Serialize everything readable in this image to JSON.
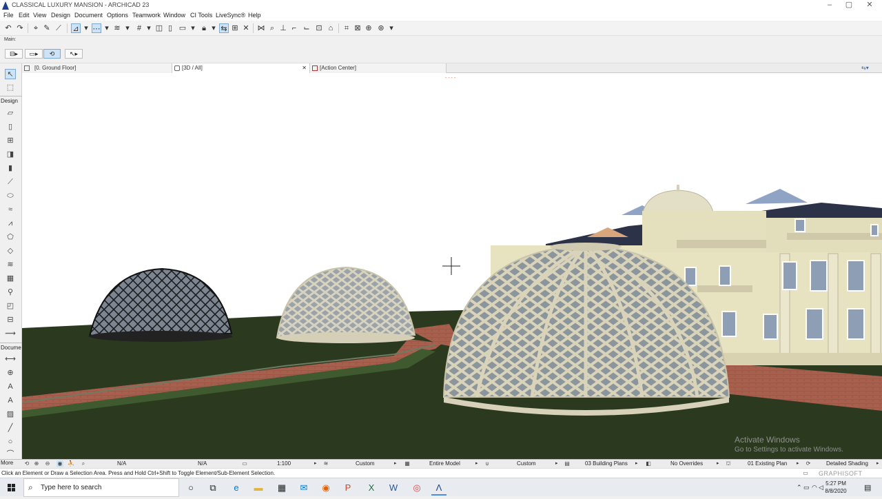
{
  "window": {
    "title": "CLASSICAL LUXURY MANSION - ARCHICAD 23",
    "controls": [
      "–",
      "▢",
      "✕"
    ]
  },
  "menu": [
    "File",
    "Edit",
    "View",
    "Design",
    "Document",
    "Options",
    "Teamwork",
    "Window",
    "CI Tools",
    "LiveSync®",
    "Help"
  ],
  "toolbar2": {
    "label": "Main:"
  },
  "tabs": [
    {
      "label": "[0. Ground Floor]"
    },
    {
      "label": "[3D / All]",
      "close": "✕"
    },
    {
      "label": "[Action Center]"
    }
  ],
  "toolbox": {
    "groups": {
      "design": "Design",
      "document": "Docume",
      "more": "More"
    }
  },
  "viewport": {
    "marker": "- - - -",
    "watermark_title": "Activate Windows",
    "watermark_sub": "Go to Settings to activate Windows."
  },
  "quick_options": {
    "na_1": "N/A",
    "na_2": "N/A",
    "scale": "1:100",
    "layer_combo": "Custom",
    "model_view": "Entire Model",
    "pen_set": "Custom",
    "mvo": "03 Building Plans",
    "overrides": "No Overrides",
    "renovation": "01 Existing Plan",
    "shading": "Detailed Shading"
  },
  "status": {
    "message": "Click an Element or Draw a Selection Area. Press and Hold Ctrl+Shift to Toggle Element/Sub-Element Selection.",
    "brand": "GRAPHISOFT"
  },
  "taskbar": {
    "search_placeholder": "Type here to search",
    "time": "5:27 PM",
    "date": "8/8/2020"
  },
  "colors": {
    "ground": "#2b3a1f",
    "path": "#a8604e",
    "dome_frame": "#d8d2b8",
    "mansion_wall": "#e7e2c0",
    "roof": "#2c3349",
    "accent": "#0078d7"
  }
}
